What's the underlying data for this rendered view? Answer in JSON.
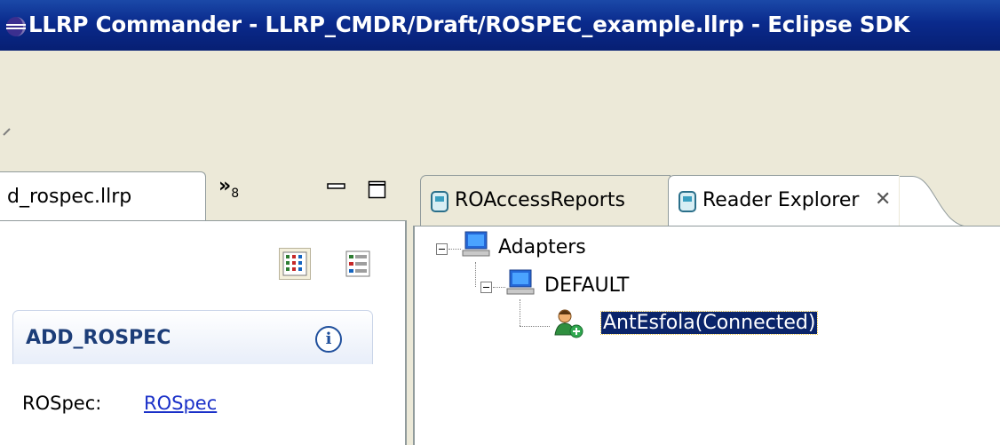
{
  "window": {
    "title": "LLRP Commander - LLRP_CMDR/Draft/ROSPEC_example.llrp - Eclipse SDK"
  },
  "left_view": {
    "tab_label": "d_rospec.llrp",
    "overflow_chevron": "»",
    "overflow_count": "8",
    "section_title": "ADD_ROSPEC",
    "info_glyph": "i",
    "field_label": "ROSpec:",
    "field_link": "ROSpec"
  },
  "right_view": {
    "tabs": [
      {
        "label": "ROAccessReports",
        "active": false
      },
      {
        "label": "Reader Explorer",
        "active": true
      }
    ],
    "close_glyph": "✕",
    "tree": [
      {
        "label": "Adapters",
        "icon": "computer-icon",
        "expanded": true
      },
      {
        "label": "DEFAULT",
        "icon": "computer-icon",
        "expanded": true
      },
      {
        "label": "AntEsfola(Connected)",
        "icon": "connected-reader-icon",
        "selected": true
      }
    ]
  },
  "colors": {
    "title_bar": "#0a2a8c",
    "selection": "#0a246a",
    "link": "#1a30c8",
    "section_title": "#1c3d78"
  }
}
